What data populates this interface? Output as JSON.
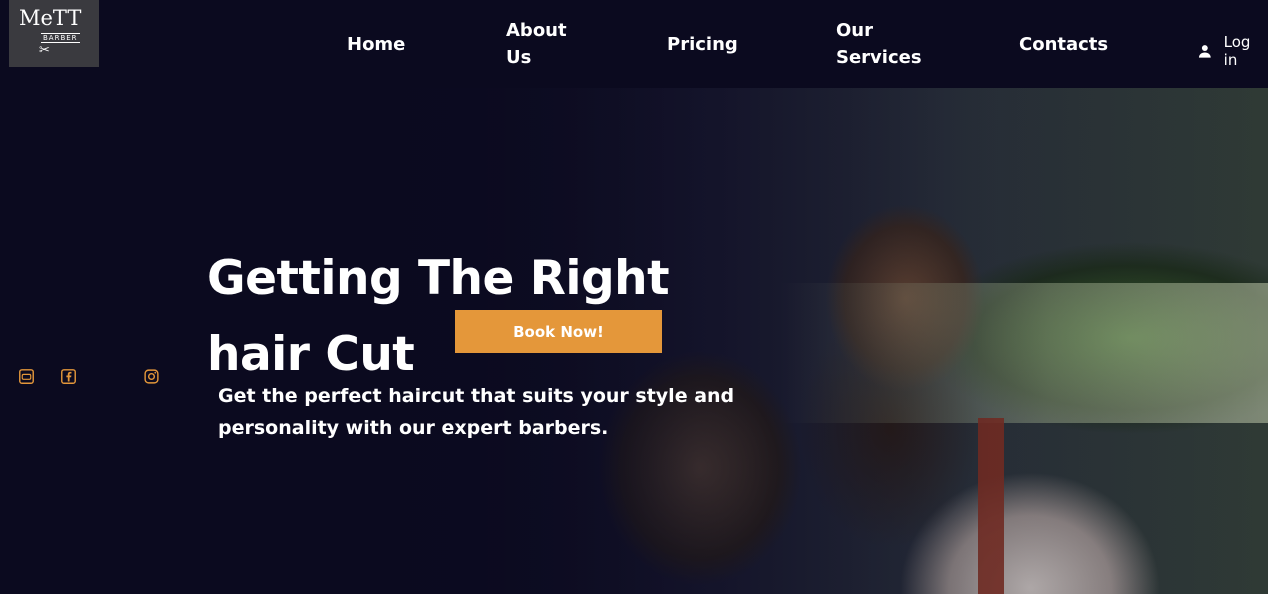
{
  "logo": {
    "line1": "MeTT",
    "line2": "BARBER"
  },
  "nav": {
    "home": "Home",
    "about": "About Us",
    "pricing": "Pricing",
    "services": "Our Services",
    "contacts": "Contacts"
  },
  "login": {
    "label": "Log in",
    "icon": "user-icon"
  },
  "hero": {
    "title": "Getting The Right hair Cut",
    "subtitle": "Get the perfect haircut that suits your style and personality with our expert barbers.",
    "cta": "Book Now!"
  },
  "social": [
    "youtube-icon",
    "facebook-icon",
    "instagram-icon"
  ],
  "colors": {
    "background": "#0b0a1f",
    "accent": "#e4973a",
    "text": "#ffffff"
  }
}
